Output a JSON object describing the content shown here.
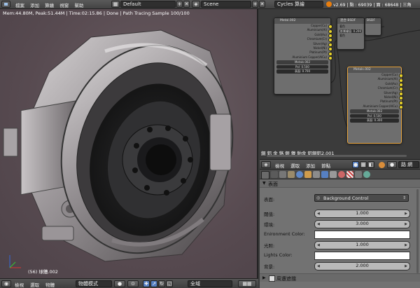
{
  "topbar": {
    "menus": [
      "檔案",
      "添加",
      "算繪",
      "視窗",
      "幫助"
    ],
    "layout": "Default",
    "scene": "Scene",
    "engine": "Cycles 算繪",
    "stats": "v2.69 | 點 : 69039 | 面 : 68648 | 三角"
  },
  "viewport": {
    "status": "Mem:44.80M, Peak:51.44M | Time:02:15.86 | Done | Path Tracing Sample 100/100",
    "object_name": "(56) 球體.002"
  },
  "bottombar": {
    "menus": [
      "檢視",
      "選取",
      "物體"
    ],
    "mode": "物體模式",
    "pivot": "全域"
  },
  "node_editor": {
    "node1": {
      "title": "Metal.002",
      "outputs": [
        "Copper(Cu)",
        "Aluminium(Al)",
        "Gold(Au)",
        "Chromium(Cr)",
        "Silver(Ag)",
        "Nickel(Ni)",
        "Platinum(Pt)",
        "Aluminium Copper(AlCu)"
      ],
      "material": "Metals.002",
      "fields": [
        "Pol: 0.500",
        "表面: 0.700"
      ]
    },
    "node2": {
      "title": "Metals.002",
      "outputs": [
        "Copper(Cu)",
        "Aluminium(Al)",
        "Gold(Au)",
        "Chromium(Cr)",
        "Silver(Ag)",
        "Nickel(Ni)",
        "Platinum(Pt)",
        "Aluminium Copper(AlCu)"
      ],
      "material": "Metals.002",
      "fields": [
        "Pol: 0.500",
        "表面: 0.300"
      ]
    },
    "node3": {
      "title": "混合 BSDF",
      "fields": [
        "著色",
        "影響權值: 0.200",
        "著色"
      ]
    },
    "node4": {
      "title": "BSDF"
    },
    "title": "銅 鋁 金 鉻 銀 鎳 鉑金 鋁銅鋁2.001"
  },
  "properties": {
    "section": "表面",
    "tab_right": "路 網",
    "menus": [
      "檢視",
      "選取",
      "添加",
      "節點"
    ],
    "surface_label": "表面:",
    "surface_value": "Background Control",
    "rows": [
      {
        "label": "閾值:",
        "value": "1.000"
      },
      {
        "label": "環境:",
        "value": "3.000"
      },
      {
        "label": "Enironment Color:",
        "value": ""
      },
      {
        "label": "光照:",
        "value": "1.000"
      },
      {
        "label": "Lights Color:",
        "value": ""
      },
      {
        "label": "背景:",
        "value": "2.000"
      }
    ],
    "collapsed_section": "周遭遮擋"
  },
  "colors": {
    "accent": "#5680c2",
    "socket": "#e8d32a",
    "viewport_bg": "#5e5157"
  }
}
